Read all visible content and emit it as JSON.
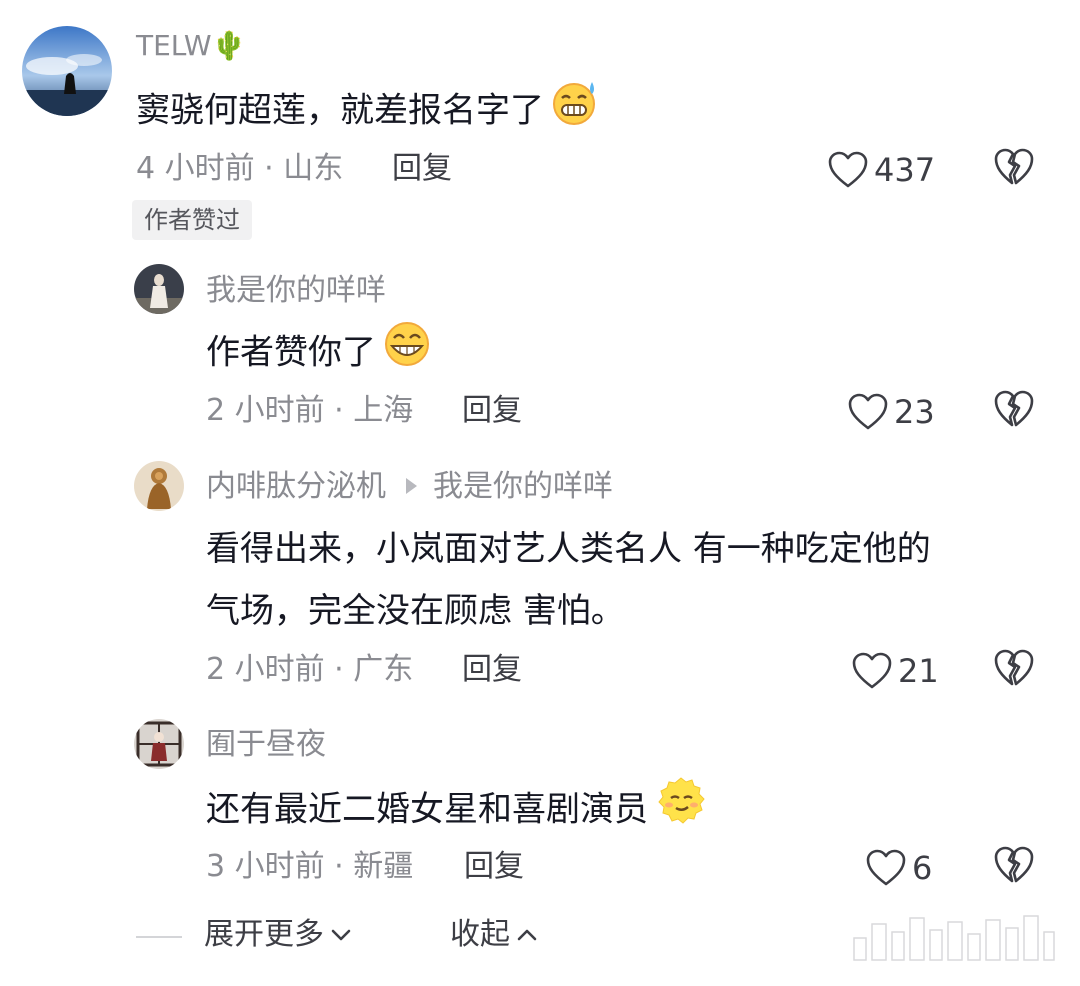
{
  "comments": [
    {
      "username": "TELW🌵",
      "text": "窦骁何超莲，就差报名字了",
      "time_location": "4 小时前 · 山东",
      "reply_label": "回复",
      "likes": "437",
      "badge": "作者赞过",
      "emoji": "grin-sweat-emoji"
    },
    {
      "username": "我是你的咩咩",
      "text": "作者赞你了",
      "time_location": "2 小时前 · 上海",
      "reply_label": "回复",
      "likes": "23",
      "emoji": "grin-emoji"
    },
    {
      "username": "内啡肽分泌机",
      "reply_to": "我是你的咩咩",
      "text_lines": [
        "看得出来，小岚面对艺人类名人 有一种吃定他的",
        "气场，完全没在顾虑 害怕。"
      ],
      "time_location": "2 小时前 · 广东",
      "reply_label": "回复",
      "likes": "21"
    },
    {
      "username": "囿于昼夜",
      "text": "还有最近二婚女星和喜剧演员",
      "time_location": "3 小时前 · 新疆",
      "reply_label": "回复",
      "likes": "6",
      "emoji": "smirk-emoji"
    }
  ],
  "footer": {
    "expand_label": "展开更多",
    "collapse_label": "收起"
  },
  "colors": {
    "text_primary": "#161823",
    "text_secondary": "#8a8b91",
    "icon": "#3d3e45",
    "badge_bg": "#f1f1f2"
  }
}
